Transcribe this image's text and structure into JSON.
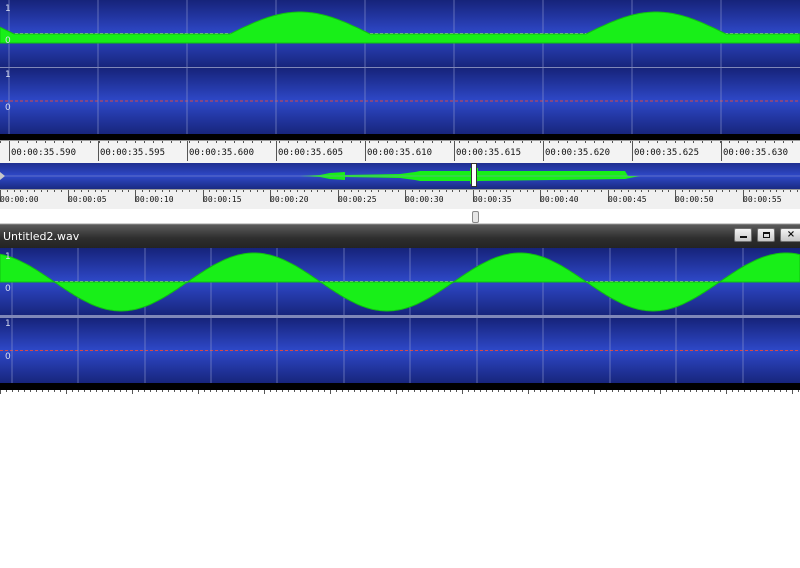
{
  "colors": {
    "wave": "#18ef18",
    "background_top": "#1d2f8f",
    "background_mid": "#2c44c2",
    "background_bottom": "#1c2c86",
    "zero_line": "#e84a3a",
    "grid": "#8d97cf"
  },
  "top_track": {
    "channel1_scale": [
      "1",
      "0"
    ],
    "channel2_scale": [
      "1",
      "0"
    ]
  },
  "time_ruler": {
    "labels": [
      "00:00:35.590",
      "00:00:35.595",
      "00:00:35.600",
      "00:00:35.605",
      "00:00:35.610",
      "00:00:35.615",
      "00:00:35.620",
      "00:00:35.625",
      "00:00:35.630"
    ]
  },
  "overview_ruler": {
    "labels": [
      "00:00:00",
      "00:00:05",
      "00:00:10",
      "00:00:15",
      "00:00:20",
      "00:00:25",
      "00:00:30",
      "00:00:35",
      "00:00:40",
      "00:00:45",
      "00:00:50",
      "00:00:55"
    ]
  },
  "window": {
    "title": "Untitled2.wav",
    "minimize_icon": "minimize-icon",
    "maximize_icon": "maximize-icon",
    "close_icon": "close-icon"
  },
  "bottom_track": {
    "channel1_scale": [
      "1",
      "0"
    ],
    "channel2_scale": [
      "1",
      "0"
    ]
  }
}
